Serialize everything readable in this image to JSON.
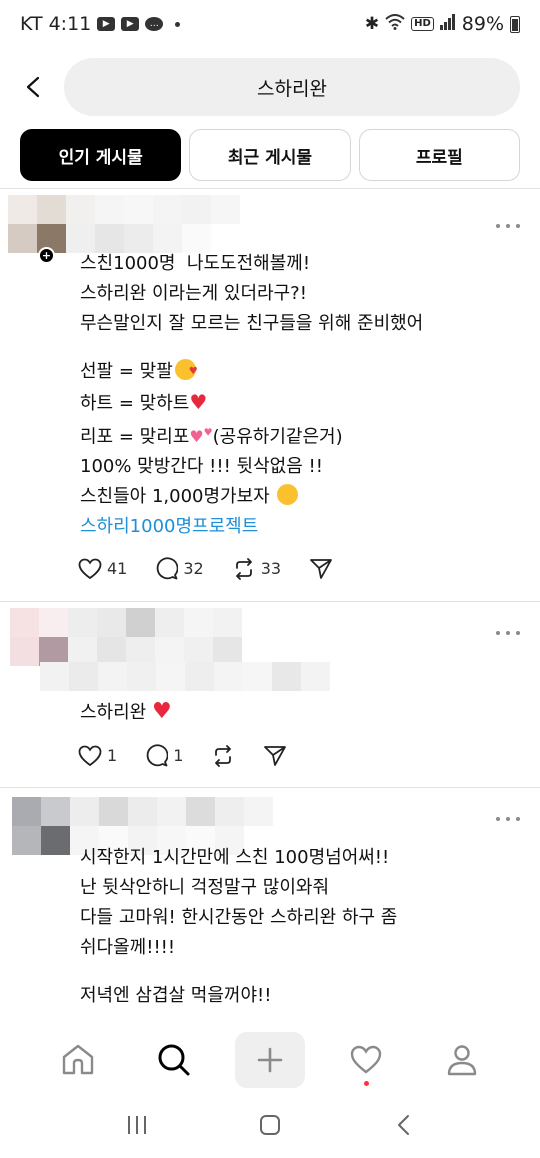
{
  "status_bar": {
    "carrier": "KT",
    "time": "4:11",
    "battery": "89%",
    "hd_label": "HD"
  },
  "search": {
    "query": "스하리완"
  },
  "tabs": [
    {
      "label": "인기 게시물",
      "active": true
    },
    {
      "label": "최근 게시물",
      "active": false
    },
    {
      "label": "프로필",
      "active": false
    }
  ],
  "posts": [
    {
      "lines": [
        "스친1000명  나도도전해볼께!",
        "스하리완 이라는게 있더라구?!",
        "무슨말인지 잘 모르는 친구들을 위해 준비했어",
        "선팔 = 맞팔",
        "하트 = 맞하트",
        "리포 = 맞리포",
        "(공유하기같은거)",
        "100% 맞방간다 !!! 뒷삭없음 !!",
        "스친들아 1,000명가보자 "
      ],
      "hashtag": "스하리1000명프로젝트",
      "likes": "41",
      "replies": "32",
      "reposts": "33"
    },
    {
      "lines": [
        "스하리완 "
      ],
      "likes": "1",
      "replies": "1"
    },
    {
      "lines": [
        "시작한지 1시간만에 스친 100명넘어써!!",
        "난 뒷삭안하니 걱정말구 많이와줘",
        "다들 고마워! 한시간동안 스하리완 하구 좀",
        "쉬다올께!!!!",
        "저녁엔 삼겹살 먹을꺼야!!"
      ]
    }
  ],
  "colors": {
    "accent": "#1e8fd8",
    "active_tab_bg": "#000000",
    "notification_dot": "#ff3040"
  }
}
